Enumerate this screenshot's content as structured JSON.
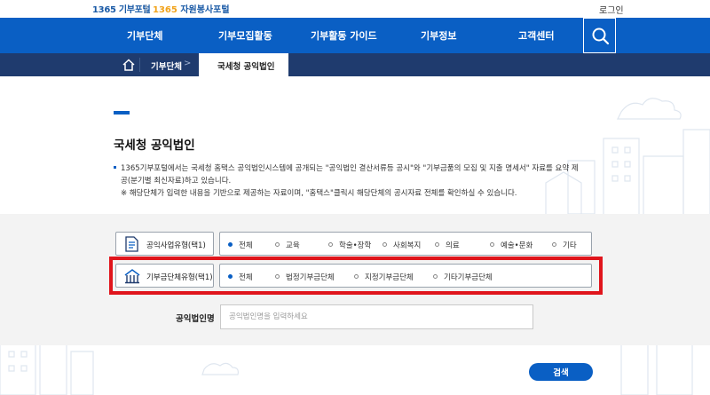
{
  "header": {
    "logo_portal_num": "1365",
    "logo_portal_text": "기부포털",
    "logo_volunteer_num": "1365",
    "logo_volunteer_text": "자원봉사포털",
    "login_label": "로그인"
  },
  "gnb": {
    "items": [
      {
        "label": "기부단체"
      },
      {
        "label": "기부모집활동"
      },
      {
        "label": "기부활동 가이드"
      },
      {
        "label": "기부정보"
      },
      {
        "label": "고객센터"
      }
    ],
    "search_icon": "search-icon"
  },
  "breadcrumb": {
    "home_icon": "home-icon",
    "level1": "기부단체",
    "separator": ">",
    "level2": "국세청 공익법인"
  },
  "page": {
    "title": "국세청 공익법인",
    "desc_line1": "1365기부포털에서는 국세청 홈택스 공익법인시스템에 공개되는 \"공익법인 결산서류등 공시\"와 \"기부금품의 모집 및 지출 명세서\" 자료를 요약 제",
    "desc_line2": "공(분기별 최신자료)하고 있습니다.",
    "desc_line3": "※ 해당단체가 입력한 내용을 기반으로 제공하는 자료이며, \"홈택스\"클릭시 해당단체의 공시자료 전체를 확인하실 수 있습니다."
  },
  "filters": {
    "business_type": {
      "label": "공익사업유형(택1)",
      "icon": "document-icon",
      "options": [
        "전체",
        "교육",
        "학술•장학",
        "사회복지",
        "의료",
        "예술•문화",
        "기타"
      ],
      "selected": "전체"
    },
    "donation_org_type": {
      "label": "기부금단체유형(택1)",
      "icon": "building-icon",
      "options": [
        "전체",
        "법정기부금단체",
        "지정기부금단체",
        "기타기부금단체"
      ],
      "selected": "전체"
    },
    "name": {
      "label": "공익법인명",
      "placeholder": "공익법인명을 입력하세요",
      "value": ""
    },
    "submit_label": "검색"
  },
  "colors": {
    "primary": "#0a5fc4",
    "breadcrumb_bg": "#1f3b6e",
    "highlight": "#e0151c",
    "filter_bg": "#f3f3f3"
  }
}
